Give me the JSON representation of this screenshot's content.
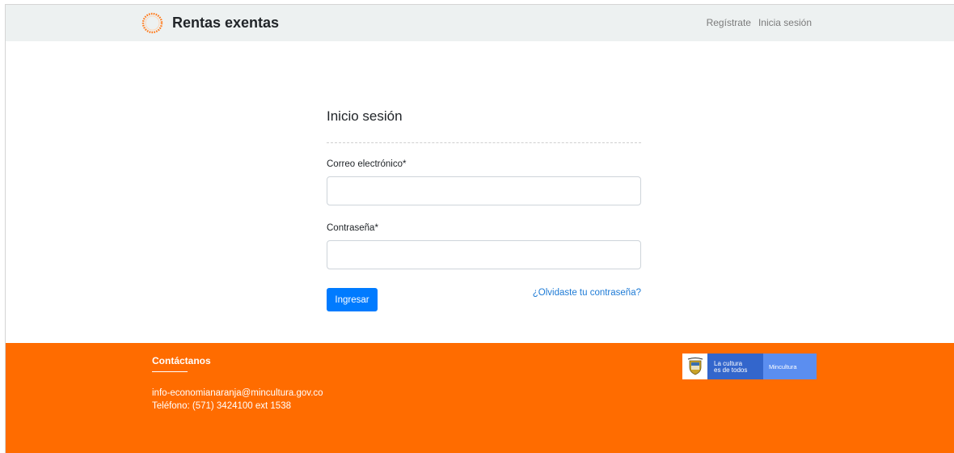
{
  "header": {
    "title": "Rentas exentas",
    "logo_icon": "orange-circle-logo",
    "nav": {
      "register": "Regístrate",
      "login": "Inicia sesión"
    }
  },
  "login": {
    "title": "Inicio sesión",
    "email_label": "Correo electrónico*",
    "email_value": "",
    "password_label": "Contraseña*",
    "password_value": "",
    "submit_label": "Ingresar",
    "forgot_label": "¿Olvidaste tu contraseña?"
  },
  "footer": {
    "title": "Contáctanos",
    "email": "info-economianaranja@mincultura.gov.co",
    "phone": "Teléfono: (571) 3424100 ext 1538",
    "gov_logo": {
      "line1": "La cultura",
      "line2": "es de todos",
      "ministry": "Mincultura"
    }
  },
  "colors": {
    "header_bg": "#edf1f1",
    "footer_bg": "#ff6c00",
    "primary": "#007bff",
    "link": "#1e7bd6",
    "gov_blue": "#3366cc",
    "gov_light_blue": "#5b8ef0"
  }
}
